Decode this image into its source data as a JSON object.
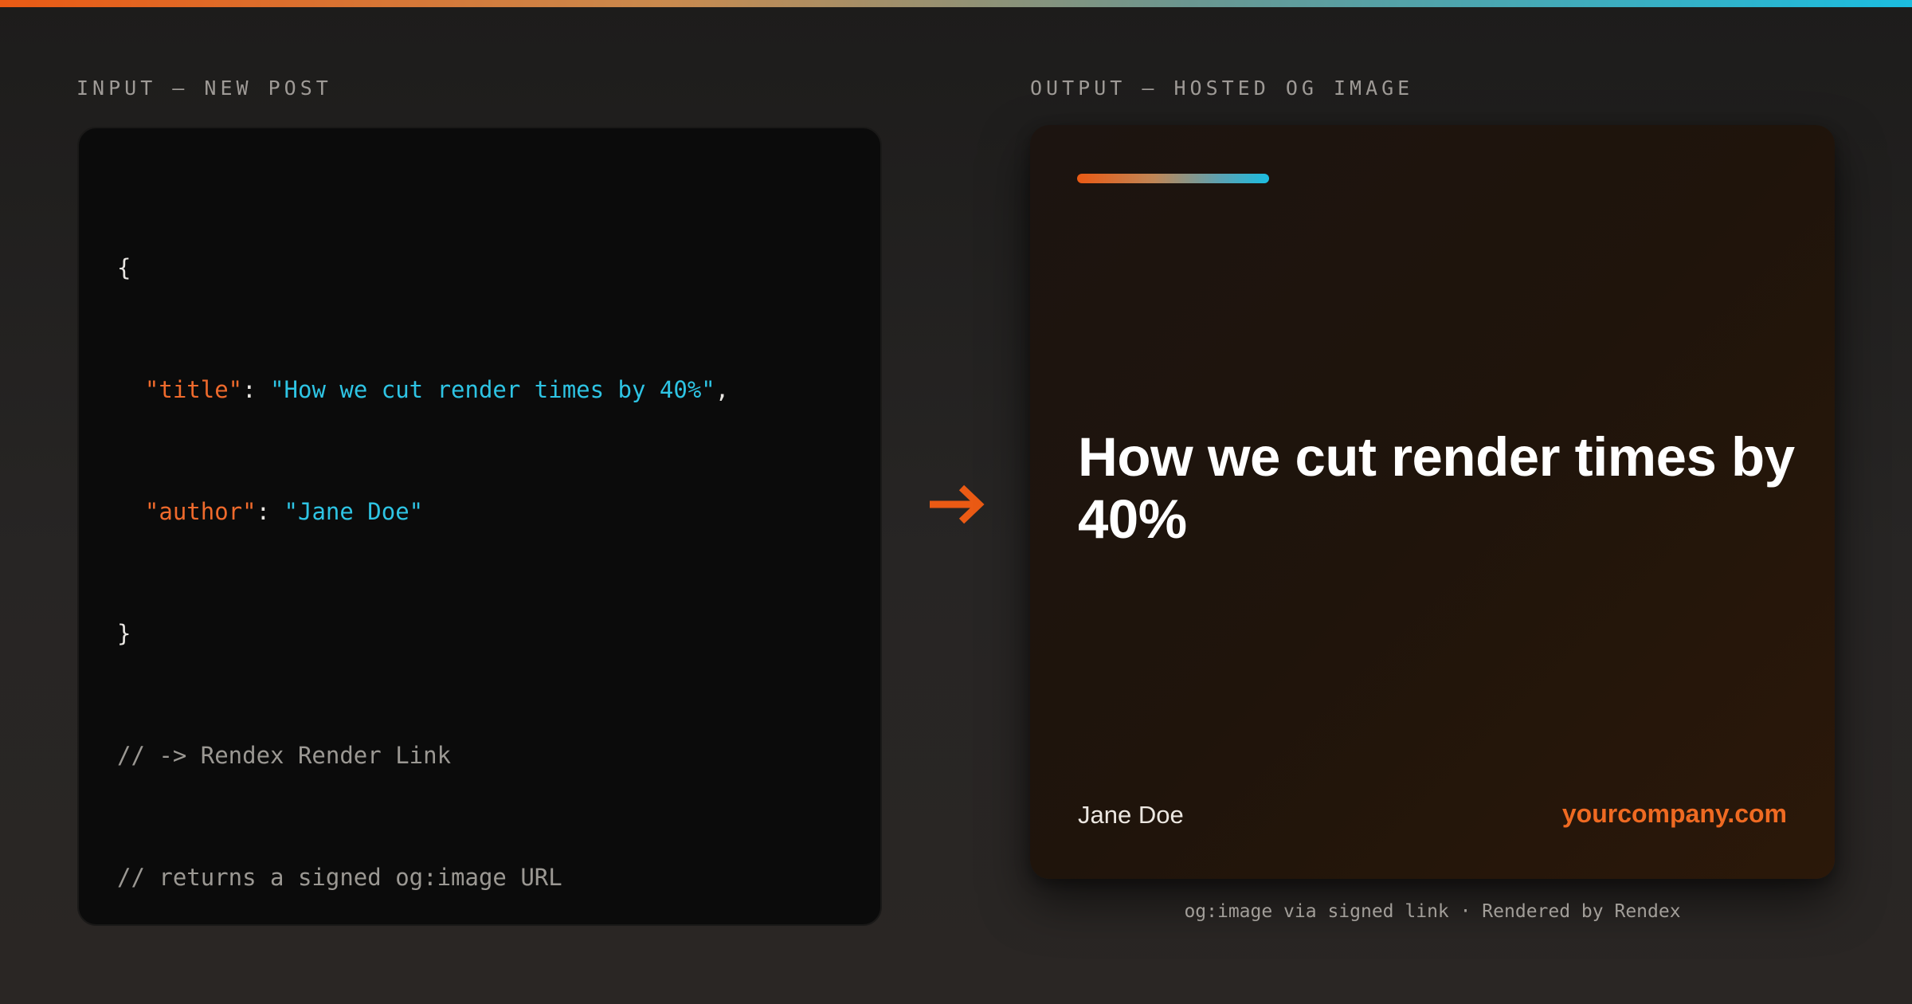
{
  "input_panel": {
    "label": "INPUT — NEW POST",
    "code": {
      "open_brace": "{",
      "title_key": "\"title\"",
      "title_value": "\"How we cut render times by 40%\"",
      "author_key": "\"author\"",
      "author_value": "\"Jane Doe\"",
      "close_brace": "}",
      "comment_1": "// -> Rendex Render Link",
      "comment_2": "// returns a signed og:image URL"
    }
  },
  "arrow": {
    "icon": "arrow-right-icon",
    "color": "#ea5a14"
  },
  "output_panel": {
    "label": "OUTPUT — HOSTED OG IMAGE",
    "card": {
      "title": "How we cut render times by 40%",
      "author": "Jane Doe",
      "domain": "yourcompany.com"
    },
    "caption": "og:image via signed link · Rendered by Rendex"
  },
  "colors": {
    "accent_orange": "#ea5a14",
    "accent_cyan": "#1bbde0",
    "code_key": "#ef6a2c",
    "code_string": "#2ec4e4",
    "background": "#232120"
  }
}
